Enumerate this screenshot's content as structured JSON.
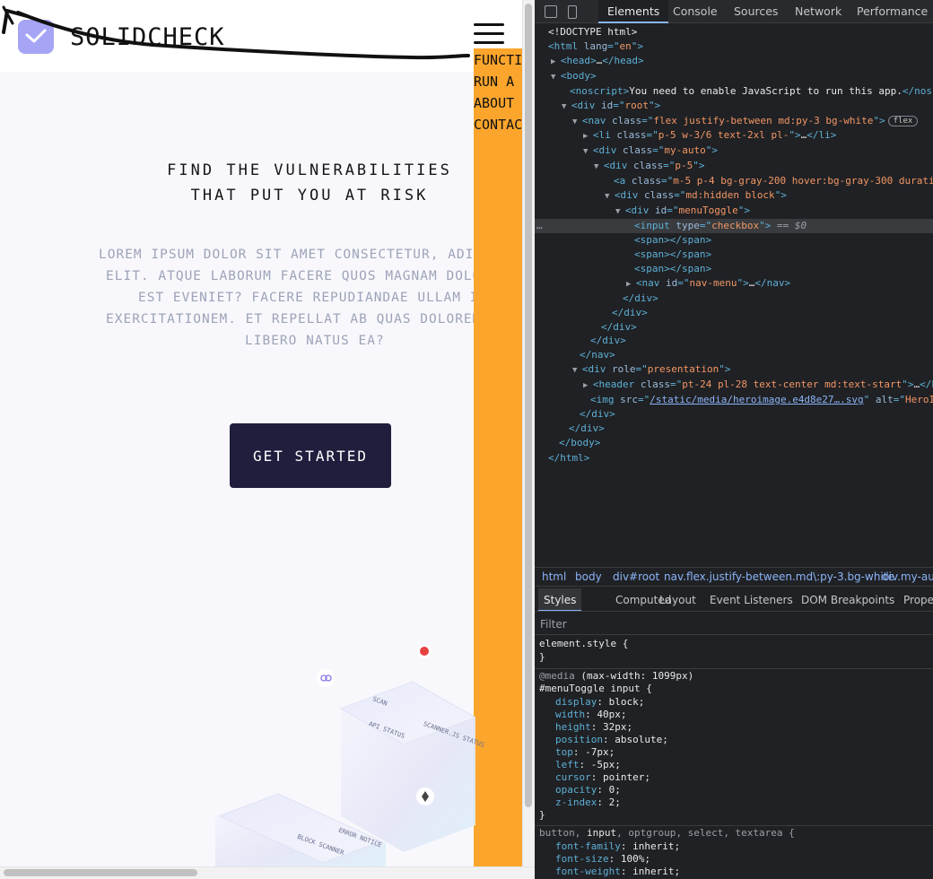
{
  "page": {
    "brand": "SOLIDCHECK",
    "menu_items": [
      "FUNCTIONS",
      "RUN A SCAN",
      "ABOUT",
      "CONTACT"
    ],
    "hero_title_lines": [
      "FIND THE VULNERABILITIES",
      "THAT PUT YOU AT RISK"
    ],
    "hero_text_lines": [
      "LOREM IPSUM DOLOR SIT AMET CONSECTETUR, ADIPISICING",
      "ELIT. ATQUE LABORUM FACERE QUOS MAGNAM DOLORE",
      "EST EVENIET? FACERE REPUDIANDAE ULLAM ILLO",
      "EXERCITATIONEM. ET REPELLAT AB QUAS DOLOREMQUE",
      "LIBERO NATUS EA?"
    ],
    "cta_label": "GET STARTED",
    "hero_image_labels": [
      "SCAN",
      "API STATUS",
      "SCANNER.JS STATUS",
      "BLOCK SCANNER",
      "ERROR NOTICE"
    ]
  },
  "devtools": {
    "tabs": [
      "Elements",
      "Console",
      "Sources",
      "Network",
      "Performance"
    ],
    "active_tab": "Elements",
    "dom": {
      "doctype": "<!DOCTYPE html>",
      "noscript_text": "You need to enable JavaScript to run this app.",
      "html_lang": "en",
      "root_id": "root",
      "nav_class": "flex justify-between md:py-3 bg-white",
      "flex_badge": "flex",
      "li_class": "p-5 w-3/6 text-2xl pl-",
      "div_class_1": "my-auto",
      "div_class_2": "p-5",
      "a_class": "m-5 p-4 bg-gray-200 hover:bg-gray-300 durati",
      "div_class_3": "md:hidden block",
      "menu_toggle_id": "menuToggle",
      "input_type": "checkbox",
      "selected_marker": "== $0",
      "nav_menu_id": "nav-menu",
      "presentation_role": "presentation",
      "header_class": "pt-24 pl-28 text-center md:text-start",
      "img_src": "/static/media/heroimage.e4d8e27….svg",
      "img_alt": "HeroI"
    },
    "breadcrumbs": [
      "html",
      "body",
      "div#root",
      "nav.flex.justify-between.md\\:py-3.bg-white",
      "div.my-auto"
    ],
    "sub_tabs": [
      "Styles",
      "Computed",
      "Layout",
      "Event Listeners",
      "DOM Breakpoints",
      "Properties"
    ],
    "active_sub_tab": "Styles",
    "filter_placeholder": "Filter",
    "styles": {
      "element_style": "element.style {",
      "media": "@media",
      "media_query": "(max-width: 1099px)",
      "rule1_selector": "#menuToggle input {",
      "rule1_props": [
        {
          "name": "display",
          "value": "block;"
        },
        {
          "name": "width",
          "value": "40px;"
        },
        {
          "name": "height",
          "value": "32px;"
        },
        {
          "name": "position",
          "value": "absolute;"
        },
        {
          "name": "top",
          "value": "-7px;"
        },
        {
          "name": "left",
          "value": "-5px;"
        },
        {
          "name": "cursor",
          "value": "pointer;"
        },
        {
          "name": "opacity",
          "value": "0;"
        },
        {
          "name": "z-index",
          "value": "2;"
        }
      ],
      "rule2_selector_parts": [
        "button, ",
        "input",
        ", optgroup, select, textarea {"
      ],
      "rule2_props": [
        {
          "name": "font-family",
          "value": "inherit;"
        },
        {
          "name": "font-size",
          "value": "100%;"
        },
        {
          "name": "font-weight",
          "value": "inherit;"
        }
      ]
    }
  },
  "colors": {
    "menu_bg": "#fca52d",
    "cta_bg": "#1f1e3d",
    "logo_bg": "#a6a4f5",
    "devtools_bg": "#202124"
  }
}
